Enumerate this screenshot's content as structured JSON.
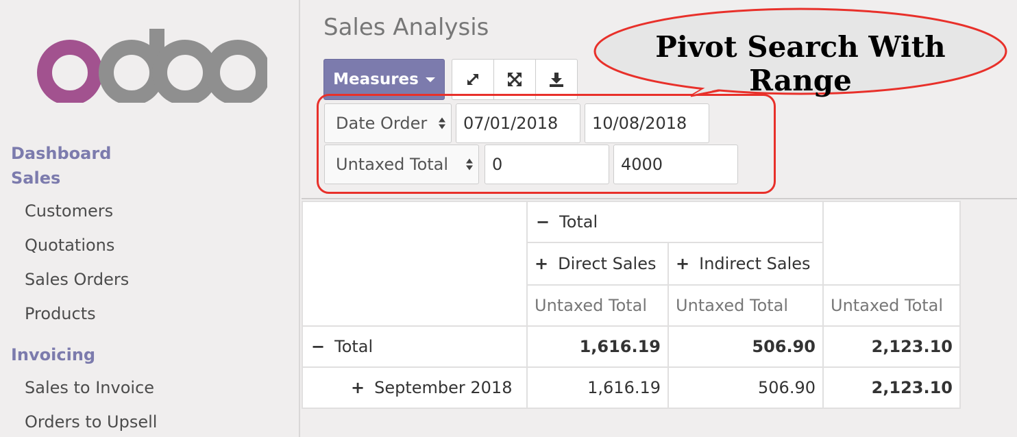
{
  "sidebar": {
    "logo_text": "odoo",
    "categories": [
      {
        "label": "Dashboard Sales"
      },
      {
        "label": "Invoicing"
      }
    ],
    "items": [
      {
        "label": "Customers"
      },
      {
        "label": "Quotations"
      },
      {
        "label": "Sales Orders"
      },
      {
        "label": "Products"
      },
      {
        "label": "Sales to Invoice"
      },
      {
        "label": "Orders to Upsell"
      }
    ],
    "category_labels": {
      "dashboard_line1": "Dashboard",
      "dashboard_line2": "Sales"
    }
  },
  "header": {
    "title": "Sales Analysis",
    "measures_label": "Measures",
    "icons": [
      "expand-icon",
      "fullscreen-icon",
      "download-icon"
    ]
  },
  "filters": {
    "row1": {
      "field": "Date Order",
      "from": "07/01/2018",
      "to": "10/08/2018"
    },
    "row2": {
      "field": "Untaxed Total",
      "from": "0",
      "to": "4000"
    }
  },
  "callout": {
    "text": "Pivot Search With Range"
  },
  "pivot": {
    "col_total": "Total",
    "col_groups": [
      "Direct Sales",
      "Indirect Sales"
    ],
    "measure": "Untaxed Total",
    "rows": [
      {
        "label": "Total",
        "values": [
          "1,616.19",
          "506.90",
          "2,123.10"
        ]
      },
      {
        "label": "September 2018",
        "values": [
          "1,616.19",
          "506.90",
          "2,123.10"
        ]
      }
    ],
    "signs": {
      "minus": "−",
      "plus": "+"
    }
  },
  "colors": {
    "accent": "#7c7bad",
    "highlight": "#e8302a",
    "logo_o": "#a2528f",
    "logo_doo": "#8f8f8f"
  }
}
